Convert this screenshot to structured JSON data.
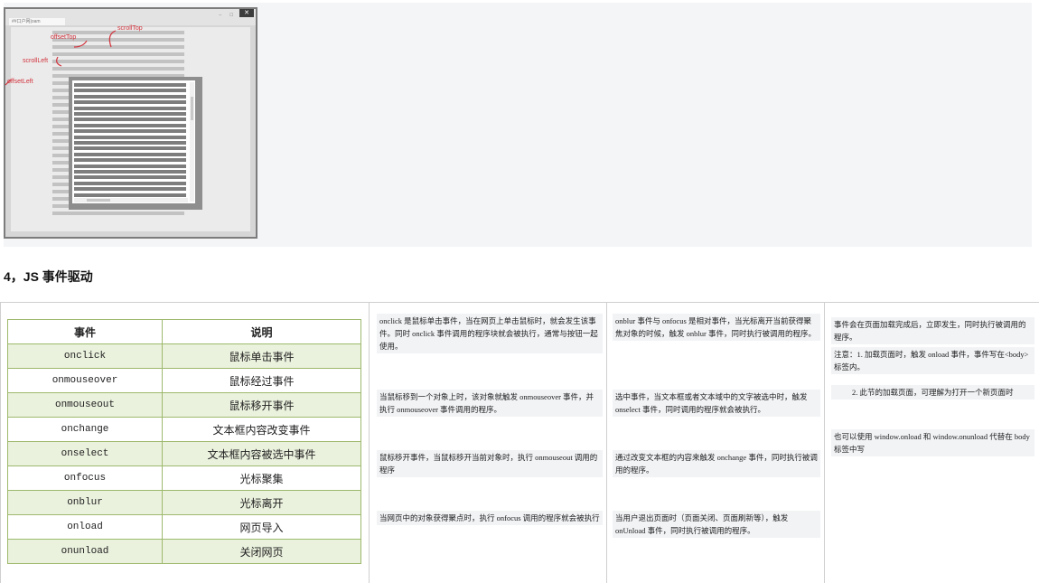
{
  "figure": {
    "tab_label": "##口户网|oam",
    "close_glyph": "✕",
    "labels": {
      "offsetTop": "offsetTop",
      "scrollTop": "scrollTop",
      "scrollLeft": "scrollLeft",
      "offsetLeft": "offsetLeft"
    }
  },
  "heading": "4，JS 事件驱动",
  "table": {
    "headers": [
      "事件",
      "说明"
    ],
    "rows": [
      {
        "event": "onclick",
        "desc": "鼠标单击事件"
      },
      {
        "event": "onmouseover",
        "desc": "鼠标经过事件"
      },
      {
        "event": "onmouseout",
        "desc": "鼠标移开事件"
      },
      {
        "event": "onchange",
        "desc": "文本框内容改变事件"
      },
      {
        "event": "onselect",
        "desc": "文本框内容被选中事件"
      },
      {
        "event": "onfocus",
        "desc": "光标聚集"
      },
      {
        "event": "onblur",
        "desc": "光标离开"
      },
      {
        "event": "onload",
        "desc": "网页导入"
      },
      {
        "event": "onunload",
        "desc": "关闭网页"
      }
    ]
  },
  "notes": {
    "col2": [
      "onclick 是鼠标单击事件，当在网页上单击鼠标时，就会发生该事件。同时 onclick 事件调用的程序块就会被执行，通常与按钮一起使用。",
      "当鼠标移到一个对象上时，该对象就触发 onmouseover 事件，并执行 onmouseover 事件调用的程序。",
      "鼠标移开事件，当鼠标移开当前对象时，执行 onmouseout 调用的程序",
      "当网页中的对象获得聚点时，执行 onfocus 调用的程序就会被执行"
    ],
    "col3": [
      "onblur 事件与 onfocus 是相对事件，当光标离开当前获得聚焦对象的时候，触发 onblur 事件，同时执行被调用的程序。",
      "选中事件，当文本框或者文本域中的文字被选中时，触发 onselect 事件，同时调用的程序就会被执行。",
      "通过改变文本框的内容来触发 onchange 事件，同时执行被调用的程序。",
      "当用户退出页面时（页面关闭、页面刷新等），触发 onUnload 事件，同时执行被调用的程序。"
    ],
    "col4": [
      "事件会在页面加载完成后，立即发生，同时执行被调用的程序。",
      "注意：1. 加载页面时，触发 onload 事件，事件写在<body>标签内。",
      "2. 此节的加载页面，可理解为打开一个新页面时",
      "也可以使用 window.onload 和 window.onunload 代替在 body 标签中写"
    ]
  }
}
